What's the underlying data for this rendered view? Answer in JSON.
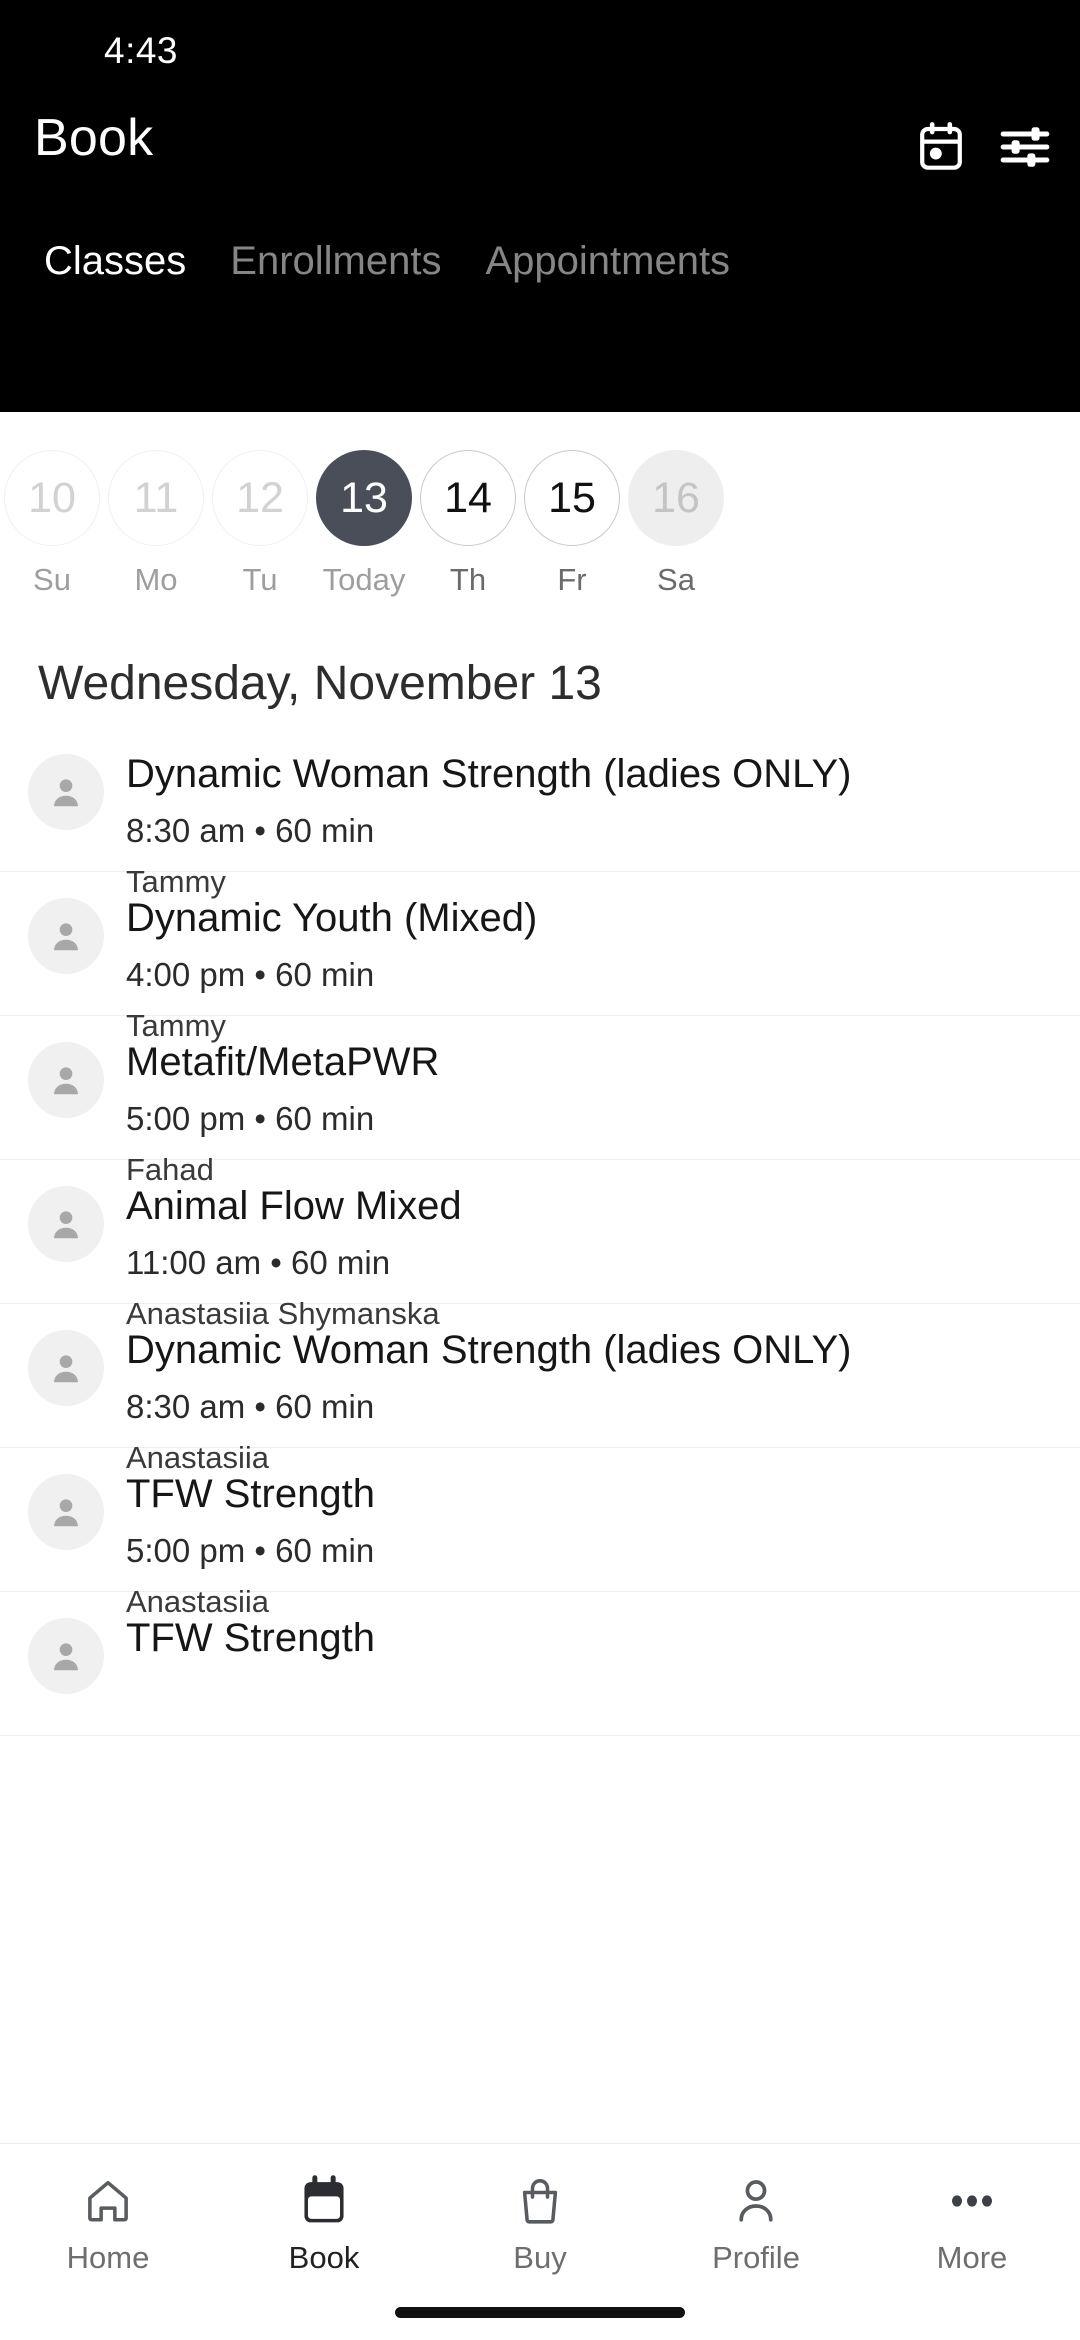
{
  "status_bar": {
    "time": "4:43"
  },
  "app_bar": {
    "title": "Book",
    "actions": [
      {
        "name": "calendar-icon",
        "label": "Calendar"
      },
      {
        "name": "filter-icon",
        "label": "Filters"
      }
    ]
  },
  "tabs": {
    "active_index": 0,
    "items": [
      {
        "label": "Classes",
        "active": true
      },
      {
        "label": "Enrollments",
        "active": false
      },
      {
        "label": "Appointments",
        "active": false
      }
    ]
  },
  "date_strip": {
    "days": [
      {
        "date": "10",
        "label": "Su",
        "state": "past"
      },
      {
        "date": "11",
        "label": "Mo",
        "state": "past"
      },
      {
        "date": "12",
        "label": "Tu",
        "state": "past"
      },
      {
        "date": "13",
        "label": "Today",
        "state": "selected"
      },
      {
        "date": "14",
        "label": "Th",
        "state": "future"
      },
      {
        "date": "15",
        "label": "Fr",
        "state": "future"
      },
      {
        "date": "16",
        "label": "Sa",
        "state": "edge"
      }
    ]
  },
  "selected_date_heading": "Wednesday, November 13",
  "classes": [
    {
      "title": "Dynamic Woman Strength (ladies ONLY)",
      "meta": "8:30 am • 60 min",
      "instructor": "Tammy"
    },
    {
      "title": "Dynamic Youth (Mixed)",
      "meta": "4:00 pm • 60 min",
      "instructor": "Tammy"
    },
    {
      "title": "Metafit/MetaPWR",
      "meta": "5:00 pm • 60 min",
      "instructor": "Fahad"
    },
    {
      "title": "Animal Flow Mixed",
      "meta": "11:00 am • 60 min",
      "instructor": "Anastasiia Shymanska"
    },
    {
      "title": "Dynamic Woman Strength (ladies ONLY)",
      "meta": "8:30 am • 60 min",
      "instructor": "Anastasiia"
    },
    {
      "title": "TFW Strength",
      "meta": "5:00 pm • 60 min",
      "instructor": "Anastasiia"
    },
    {
      "title": "TFW Strength",
      "meta": "",
      "instructor": ""
    }
  ],
  "bottom_nav": {
    "active_index": 1,
    "items": [
      {
        "label": "Home",
        "icon": "home-icon",
        "active": false
      },
      {
        "label": "Book",
        "icon": "calendar-icon",
        "active": true
      },
      {
        "label": "Buy",
        "icon": "shopping-bag-icon",
        "active": false
      },
      {
        "label": "Profile",
        "icon": "person-icon",
        "active": false
      },
      {
        "label": "More",
        "icon": "ellipsis-icon",
        "active": false
      }
    ]
  },
  "colors": {
    "header_background": "#000000",
    "selected_day": "#4a4e58",
    "accent_text": "#ffffff",
    "muted_text": "#9e9e9e",
    "divider": "#eeeeee"
  }
}
